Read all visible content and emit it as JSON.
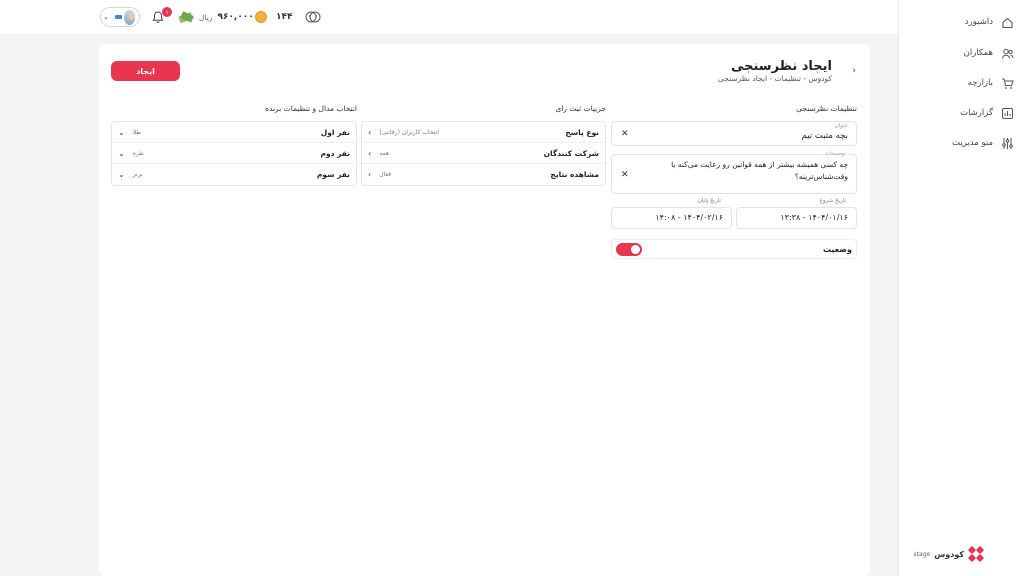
{
  "topbar": {
    "money": "۹۶۰,۰۰۰",
    "money_unit": "ریال",
    "coins": "۱۴۴",
    "notification_count": "۱"
  },
  "sidebar": {
    "items": [
      {
        "label": "داشبورد",
        "icon": "home-icon"
      },
      {
        "label": "همکاران",
        "icon": "users-icon"
      },
      {
        "label": "بازارچه",
        "icon": "cart-icon"
      },
      {
        "label": "گزارشات",
        "icon": "chart-icon"
      },
      {
        "label": "منو مدیریت",
        "icon": "sliders-icon"
      }
    ],
    "brand": "کودوس",
    "brand_suffix": "stage"
  },
  "header": {
    "title": "ایجاد نظرسنجی",
    "breadcrumb": "کودوس - تنظیمات - ایجاد نظرسنجی",
    "create_label": "ایجاد"
  },
  "settings": {
    "heading": "تنظیمات نظرسنجی",
    "title_label": "عنوان",
    "title_value": "بچه مثبت تیم",
    "desc_label": "توضیحات",
    "desc_line1": "چه کسی همیشه بیشتر از همه قوانین رو رعایت می‌کنه یا",
    "desc_line2": "وقت‌شناس‌تر‌ینه؟",
    "start_label": "تاریخ شروع",
    "start_value": "۱۴۰۴/۰۱/۱۶ - ۱۳:۳۸",
    "end_label": "تاریخ پایان",
    "end_value": "۱۴۰۴/۰۲/۱۶ - ۱۴:۰۸",
    "status_label": "وضعیت"
  },
  "details": {
    "heading": "جزییات ثبت رای",
    "rows": [
      {
        "label": "نوع پاسخ",
        "value": "انتخاب کاربران (رقابتی)"
      },
      {
        "label": "شرکت کنندگان",
        "value": "همه"
      },
      {
        "label": "مشاهده نتایج",
        "value": "فعال"
      }
    ]
  },
  "medals": {
    "heading": "انتخاب مدال و تنظیمات برنده",
    "rows": [
      {
        "label": "نفر اول",
        "value": "طلا"
      },
      {
        "label": "نفر دوم",
        "value": "نقره"
      },
      {
        "label": "نفر سوم",
        "value": "برنز"
      }
    ]
  },
  "colors": {
    "accent": "#e8364f"
  }
}
